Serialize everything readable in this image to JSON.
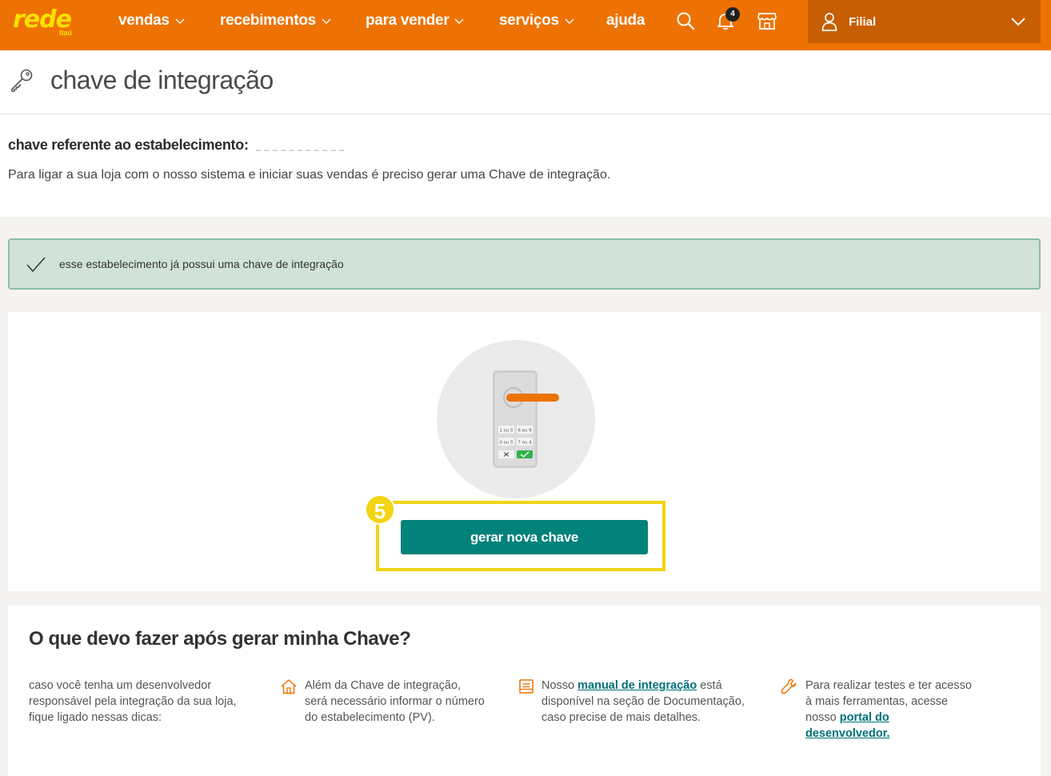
{
  "brand": {
    "name": "rede",
    "sub": "Itaú",
    "color": "#ee7203",
    "accent": "#fde000"
  },
  "nav": {
    "items": [
      {
        "label": "vendas",
        "has_dropdown": true
      },
      {
        "label": "recebimentos",
        "has_dropdown": true
      },
      {
        "label": "para vender",
        "has_dropdown": true
      },
      {
        "label": "serviços",
        "has_dropdown": true
      },
      {
        "label": "ajuda",
        "has_dropdown": false
      }
    ],
    "icons": [
      "search-icon",
      "bell-icon",
      "store-icon"
    ],
    "notifications_count": "4",
    "account": {
      "label": "Filial",
      "icon": "user-icon"
    }
  },
  "page": {
    "title": "chave de integração",
    "icon": "key-icon"
  },
  "info": {
    "ref_label": "chave referente ao estabelecimento:",
    "description": "Para ligar a sua loja com o nosso sistema e iniciar suas vendas é preciso gerar uma Chave de integração."
  },
  "alert": {
    "message": "esse estabelecimento já possui uma chave de integração",
    "icon": "check-icon"
  },
  "keycard": {
    "keypad": [
      "1 ou 5",
      "6 ou 9",
      "0 ou 5",
      "7 ou 4"
    ],
    "step_number": "5",
    "button_label": "gerar nova chave",
    "button_color": "#00817a",
    "highlight_color": "#f2d414"
  },
  "help": {
    "title": "O que devo fazer após gerar minha Chave?",
    "intro": "caso você tenha um desenvolvedor responsável pela integração da sua loja, fique ligado nessas dicas:",
    "tip1": "Além da Chave de integração, será necessário informar o número do estabelecimento (PV).",
    "tip2_before": "Nosso ",
    "tip2_link": "manual de integração",
    "tip2_after": " está disponível na seção de Documentação, caso precise de mais detalhes.",
    "tip3_before": "Para realizar testes e ter acesso à mais ferramentas, acesse nosso ",
    "tip3_link": "portal do desenvolvedor."
  }
}
